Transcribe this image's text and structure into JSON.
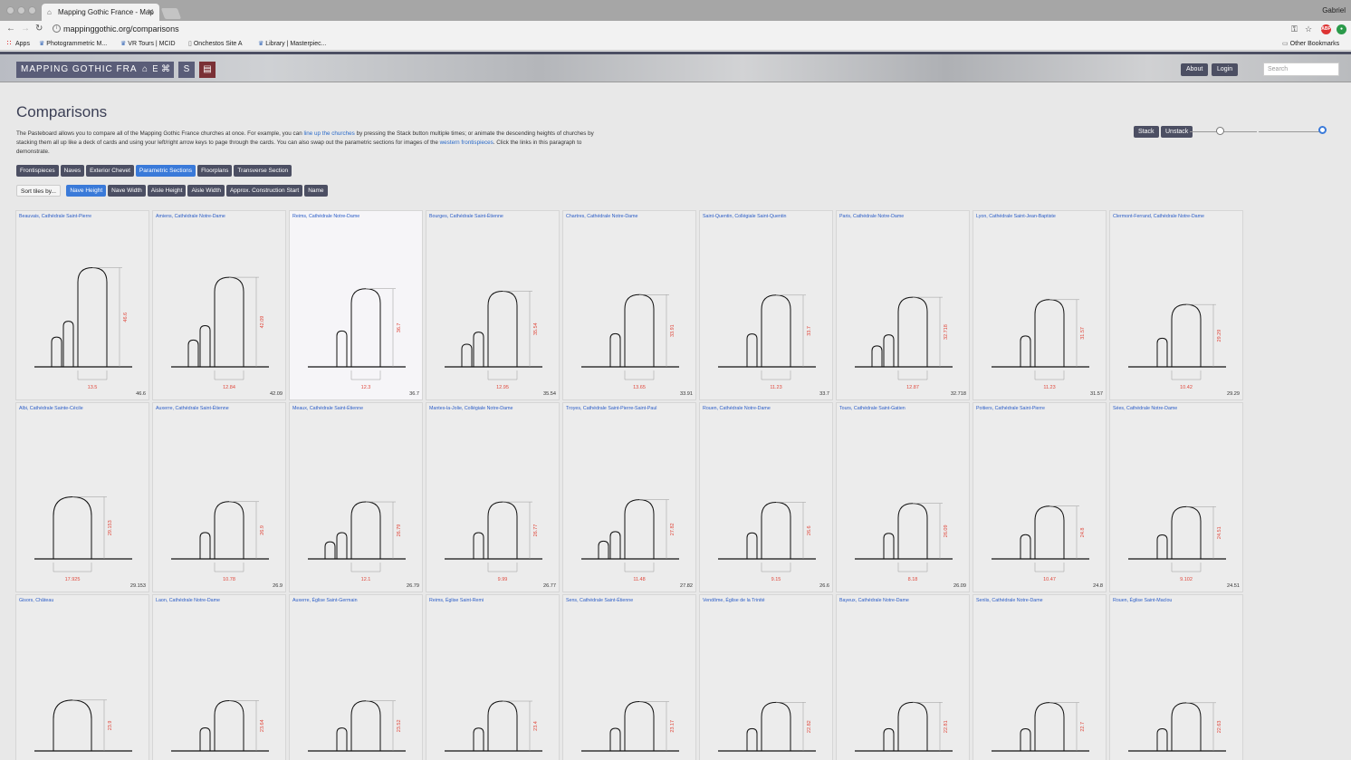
{
  "browser": {
    "tab_title": "Mapping Gothic France - Map",
    "profile": "Gabriel",
    "url": "mappinggothic.org/comparisons",
    "bookmarks": [
      "Apps",
      "Photogrammetric M...",
      "VR Tours | MCID",
      "Onchestos Site A",
      "Library | Masterpiec..."
    ],
    "other_bookmarks": "Other Bookmarks"
  },
  "header": {
    "logo": "MAPPING GOTHIC FRANCE",
    "about": "About",
    "login": "Login",
    "search_placeholder": "Search"
  },
  "page": {
    "title": "Comparisons",
    "intro_1": "The Pasteboard allows you to compare all of the Mapping Gothic France churches at once. For example, you can ",
    "intro_link_1": "line up the churches",
    "intro_2": " by pressing the Stack button multiple times; or animate the descending heights of churches by stacking them all up like a deck of cards and using your left/right arrow keys to page through the cards. You can also swap out the parametric sections for images of the ",
    "intro_link_2": "western frontispieces",
    "intro_3": ". Click the links in this paragraph to demonstrate."
  },
  "controls": {
    "stack": "Stack",
    "unstack": "Unstack",
    "slider_1": 0.45,
    "slider_2": 1.0
  },
  "views": [
    {
      "label": "Frontispieces",
      "active": false
    },
    {
      "label": "Naves",
      "active": false
    },
    {
      "label": "Exterior Chevet",
      "active": false
    },
    {
      "label": "Parametric Sections",
      "active": true
    },
    {
      "label": "Floorplans",
      "active": false
    },
    {
      "label": "Transverse Section",
      "active": false
    }
  ],
  "sort": {
    "label": "Sort tiles by...",
    "options": [
      {
        "label": "Nave Height",
        "active": true
      },
      {
        "label": "Nave Width",
        "active": false
      },
      {
        "label": "Aisle Height",
        "active": false
      },
      {
        "label": "Aisle Width",
        "active": false
      },
      {
        "label": "Approx. Construction Start",
        "active": false
      },
      {
        "label": "Name",
        "active": false
      }
    ]
  },
  "colors": {
    "accent": "#3a7ad9",
    "dark": "#4c4f63",
    "measure": "#e0483c",
    "link": "#2a5cc7"
  },
  "churches": [
    {
      "name": "Beauvais, Cathédrale Saint-Pierre",
      "height": "46.6",
      "width": "13.5",
      "value": "46.6",
      "aisles": 2,
      "highlight": false
    },
    {
      "name": "Amiens, Cathédrale Notre-Dame",
      "height": "42.09",
      "width": "12.84",
      "value": "42.09",
      "aisles": 2,
      "highlight": false
    },
    {
      "name": "Reims, Cathédrale Notre-Dame",
      "height": "36.7",
      "width": "12.3",
      "value": "36.7",
      "aisles": 1,
      "highlight": true
    },
    {
      "name": "Bourges, Cathédrale Saint-Étienne",
      "height": "35.54",
      "width": "12.95",
      "value": "35.54",
      "aisles": 2,
      "highlight": false
    },
    {
      "name": "Chartres, Cathédrale Notre-Dame",
      "height": "33.91",
      "width": "13.65",
      "value": "33.91",
      "aisles": 1,
      "highlight": false
    },
    {
      "name": "Saint-Quentin, Collégiale Saint-Quentin",
      "height": "33.7",
      "width": "11.23",
      "value": "33.7",
      "aisles": 1,
      "highlight": false
    },
    {
      "name": "Paris, Cathédrale Notre-Dame",
      "height": "32.718",
      "width": "12.87",
      "value": "32.718",
      "aisles": 2,
      "highlight": false
    },
    {
      "name": "Lyon, Cathédrale Saint-Jean-Baptiste",
      "height": "31.57",
      "width": "11.23",
      "value": "31.57",
      "aisles": 1,
      "highlight": false
    },
    {
      "name": "Clermont-Ferrand, Cathédrale Notre-Dame",
      "height": "29.29",
      "width": "10.42",
      "value": "29.29",
      "aisles": 1,
      "highlight": false
    },
    {
      "name": "Albi, Cathédrale Sainte-Cécile",
      "height": "29.153",
      "width": "17.925",
      "value": "29.153",
      "aisles": 0,
      "highlight": false
    },
    {
      "name": "Auxerre, Cathédrale Saint-Étienne",
      "height": "26.9",
      "width": "10.78",
      "value": "26.9",
      "aisles": 1,
      "highlight": false
    },
    {
      "name": "Meaux, Cathédrale Saint-Étienne",
      "height": "26.79",
      "width": "12.1",
      "value": "26.79",
      "aisles": 2,
      "highlight": false
    },
    {
      "name": "Mantes-la-Jolie, Collégiale Notre-Dame",
      "height": "26.77",
      "width": "9.99",
      "value": "26.77",
      "aisles": 1,
      "highlight": false
    },
    {
      "name": "Troyes, Cathédrale Saint-Pierre-Saint-Paul",
      "height": "27.82",
      "width": "11.48",
      "value": "27.82",
      "aisles": 2,
      "highlight": false
    },
    {
      "name": "Rouen, Cathédrale Notre-Dame",
      "height": "26.6",
      "width": "9.15",
      "value": "26.6",
      "aisles": 1,
      "highlight": false
    },
    {
      "name": "Tours, Cathédrale Saint-Gatien",
      "height": "26.09",
      "width": "8.18",
      "value": "26.09",
      "aisles": 1,
      "highlight": false
    },
    {
      "name": "Poitiers, Cathédrale Saint-Pierre",
      "height": "24.8",
      "width": "10.47",
      "value": "24.8",
      "aisles": 1,
      "highlight": false
    },
    {
      "name": "Sées, Cathédrale Notre-Dame",
      "height": "24.51",
      "width": "9.102",
      "value": "24.51",
      "aisles": 1,
      "highlight": false
    },
    {
      "name": "Gisors, Château",
      "height": "23.9",
      "width": "",
      "value": "",
      "aisles": 0,
      "highlight": false
    },
    {
      "name": "Laon, Cathédrale Notre-Dame",
      "height": "23.64",
      "width": "",
      "value": "",
      "aisles": 1,
      "highlight": false
    },
    {
      "name": "Auxerre, Église Saint-Germain",
      "height": "23.52",
      "width": "",
      "value": "",
      "aisles": 1,
      "highlight": false
    },
    {
      "name": "Reims, Église Saint-Remi",
      "height": "23.4",
      "width": "",
      "value": "",
      "aisles": 1,
      "highlight": false
    },
    {
      "name": "Sens, Cathédrale Saint-Étienne",
      "height": "23.17",
      "width": "",
      "value": "",
      "aisles": 1,
      "highlight": false
    },
    {
      "name": "Vendôme, Église de la Trinité",
      "height": "22.82",
      "width": "",
      "value": "",
      "aisles": 1,
      "highlight": false
    },
    {
      "name": "Bayeux, Cathédrale Notre-Dame",
      "height": "22.81",
      "width": "",
      "value": "",
      "aisles": 1,
      "highlight": false
    },
    {
      "name": "Senlis, Cathédrale Notre-Dame",
      "height": "22.7",
      "width": "",
      "value": "",
      "aisles": 1,
      "highlight": false
    },
    {
      "name": "Rouen, Église Saint-Maclou",
      "height": "22.63",
      "width": "",
      "value": "",
      "aisles": 1,
      "highlight": false
    }
  ]
}
